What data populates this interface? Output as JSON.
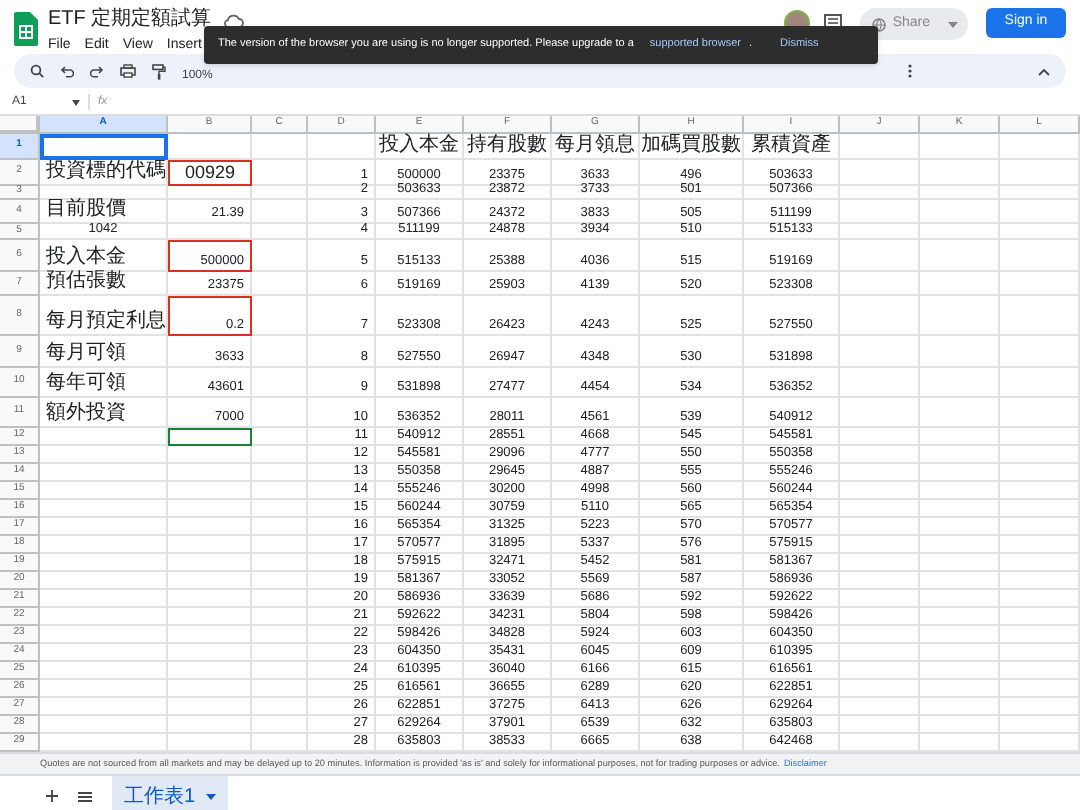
{
  "document": {
    "title": "ETF 定期定額試算",
    "menus": [
      "File",
      "Edit",
      "View",
      "Insert"
    ]
  },
  "account": {
    "share_label": "Share",
    "sign_in_label": "Sign in"
  },
  "banner": {
    "message": "The version of the browser you are using is no longer supported. Please upgrade to a",
    "link": "supported browser",
    "period": ".",
    "dismiss": "Dismiss"
  },
  "toolbar": {
    "zoom": "100%"
  },
  "formula_bar": {
    "cell_ref": "A1",
    "fx": "fx"
  },
  "columns": [
    {
      "label": "A",
      "selected": true
    },
    {
      "label": "B",
      "selected": false
    },
    {
      "label": "C",
      "selected": false
    },
    {
      "label": "D",
      "selected": false
    },
    {
      "label": "E",
      "selected": false
    },
    {
      "label": "F",
      "selected": false
    },
    {
      "label": "G",
      "selected": false
    },
    {
      "label": "H",
      "selected": false
    },
    {
      "label": "I",
      "selected": false
    },
    {
      "label": "J",
      "selected": false
    },
    {
      "label": "K",
      "selected": false
    },
    {
      "label": "L",
      "selected": false
    }
  ],
  "rows": [
    {
      "header": "1",
      "selected": true,
      "cells": {
        "E": "投入本金",
        "F": "持有股數",
        "G": "每月領息",
        "H": "加碼買股數",
        "I": "累積資產"
      }
    },
    {
      "header": "2",
      "selected": false,
      "cells": {
        "A": "投資標的代碼",
        "B": {
          "text": "00929",
          "kind": "code",
          "outlined": true
        },
        "D": "1",
        "E": "500000",
        "F": "23375",
        "G": "3633",
        "H": "496",
        "I": "503633"
      }
    },
    {
      "header": "3",
      "selected": false,
      "cells": {
        "D": "2",
        "E": "503633",
        "F": "23872",
        "G": "3733",
        "H": "501",
        "I": "507366"
      }
    },
    {
      "header": "4",
      "selected": false,
      "cells": {
        "A": "目前股價",
        "B": "21.39",
        "D": "3",
        "E": "507366",
        "F": "24372",
        "G": "3833",
        "H": "505",
        "I": "511199"
      }
    },
    {
      "header": "5",
      "selected": false,
      "cells": {
        "A": {
          "text": "1042",
          "kind": "number"
        },
        "D": "4",
        "E": "511199",
        "F": "24878",
        "G": "3934",
        "H": "510",
        "I": "515133"
      }
    },
    {
      "header": "6",
      "selected": false,
      "cells": {
        "A": "投入本金",
        "B": {
          "text": "500000",
          "outlined": true
        },
        "D": "5",
        "E": "515133",
        "F": "25388",
        "G": "4036",
        "H": "515",
        "I": "519169"
      }
    },
    {
      "header": "7",
      "selected": false,
      "cells": {
        "A": "預估張數",
        "B": "23375",
        "D": "6",
        "E": "519169",
        "F": "25903",
        "G": "4139",
        "H": "520",
        "I": "523308"
      }
    },
    {
      "header": "8",
      "selected": false,
      "cells": {
        "A": "每月預定利息",
        "B": {
          "text": "0.2",
          "outlined": true
        },
        "D": "7",
        "E": "523308",
        "F": "26423",
        "G": "4243",
        "H": "525",
        "I": "527550"
      }
    },
    {
      "header": "9",
      "selected": false,
      "cells": {
        "A": "每月可領",
        "B": "3633",
        "D": "8",
        "E": "527550",
        "F": "26947",
        "G": "4348",
        "H": "530",
        "I": "531898"
      }
    },
    {
      "header": "10",
      "selected": false,
      "cells": {
        "A": "每年可領",
        "B": "43601",
        "D": "9",
        "E": "531898",
        "F": "27477",
        "G": "4454",
        "H": "534",
        "I": "536352"
      }
    },
    {
      "header": "11",
      "selected": false,
      "cells": {
        "A": "額外投資",
        "B": "7000",
        "D": "10",
        "E": "536352",
        "F": "28011",
        "G": "4561",
        "H": "539",
        "I": "540912"
      }
    },
    {
      "header": "12",
      "selected": false,
      "cells": {
        "B": {
          "copy_marked": true
        },
        "D": "11",
        "E": "540912",
        "F": "28551",
        "G": "4668",
        "H": "545",
        "I": "545581"
      }
    },
    {
      "header": "13",
      "selected": false,
      "cells": {
        "D": "12",
        "E": "545581",
        "F": "29096",
        "G": "4777",
        "H": "550",
        "I": "550358"
      }
    },
    {
      "header": "14",
      "selected": false,
      "cells": {
        "D": "13",
        "E": "550358",
        "F": "29645",
        "G": "4887",
        "H": "555",
        "I": "555246"
      }
    },
    {
      "header": "15",
      "selected": false,
      "cells": {
        "D": "14",
        "E": "555246",
        "F": "30200",
        "G": "4998",
        "H": "560",
        "I": "560244"
      }
    },
    {
      "header": "16",
      "selected": false,
      "cells": {
        "D": "15",
        "E": "560244",
        "F": "30759",
        "G": "5110",
        "H": "565",
        "I": "565354"
      }
    },
    {
      "header": "17",
      "selected": false,
      "cells": {
        "D": "16",
        "E": "565354",
        "F": "31325",
        "G": "5223",
        "H": "570",
        "I": "570577"
      }
    },
    {
      "header": "18",
      "selected": false,
      "cells": {
        "D": "17",
        "E": "570577",
        "F": "31895",
        "G": "5337",
        "H": "576",
        "I": "575915"
      }
    },
    {
      "header": "19",
      "selected": false,
      "cells": {
        "D": "18",
        "E": "575915",
        "F": "32471",
        "G": "5452",
        "H": "581",
        "I": "581367"
      }
    },
    {
      "header": "20",
      "selected": false,
      "cells": {
        "D": "19",
        "E": "581367",
        "F": "33052",
        "G": "5569",
        "H": "587",
        "I": "586936"
      }
    },
    {
      "header": "21",
      "selected": false,
      "cells": {
        "D": "20",
        "E": "586936",
        "F": "33639",
        "G": "5686",
        "H": "592",
        "I": "592622"
      }
    },
    {
      "header": "22",
      "selected": false,
      "cells": {
        "D": "21",
        "E": "592622",
        "F": "34231",
        "G": "5804",
        "H": "598",
        "I": "598426"
      }
    },
    {
      "header": "23",
      "selected": false,
      "cells": {
        "D": "22",
        "E": "598426",
        "F": "34828",
        "G": "5924",
        "H": "603",
        "I": "604350"
      }
    },
    {
      "header": "24",
      "selected": false,
      "cells": {
        "D": "23",
        "E": "604350",
        "F": "35431",
        "G": "6045",
        "H": "609",
        "I": "610395"
      }
    },
    {
      "header": "25",
      "selected": false,
      "cells": {
        "D": "24",
        "E": "610395",
        "F": "36040",
        "G": "6166",
        "H": "615",
        "I": "616561"
      }
    },
    {
      "header": "26",
      "selected": false,
      "cells": {
        "D": "25",
        "E": "616561",
        "F": "36655",
        "G": "6289",
        "H": "620",
        "I": "622851"
      }
    },
    {
      "header": "27",
      "selected": false,
      "cells": {
        "D": "26",
        "E": "622851",
        "F": "37275",
        "G": "6413",
        "H": "626",
        "I": "629264"
      }
    },
    {
      "header": "28",
      "selected": false,
      "cells": {
        "D": "27",
        "E": "629264",
        "F": "37901",
        "G": "6539",
        "H": "632",
        "I": "635803"
      }
    },
    {
      "header": "29",
      "selected": false,
      "cells": {
        "D": "28",
        "E": "635803",
        "F": "38533",
        "G": "6665",
        "H": "638",
        "I": "642468"
      }
    }
  ],
  "disclaimer": {
    "text": "Quotes are not sourced from all markets and may be delayed up to 20 minutes. Information is provided 'as is' and solely for informational purposes, not for trading purposes or advice.",
    "link": "Disclaimer"
  },
  "sheet_tabs": [
    {
      "label": "工作表1",
      "selected": true
    }
  ]
}
